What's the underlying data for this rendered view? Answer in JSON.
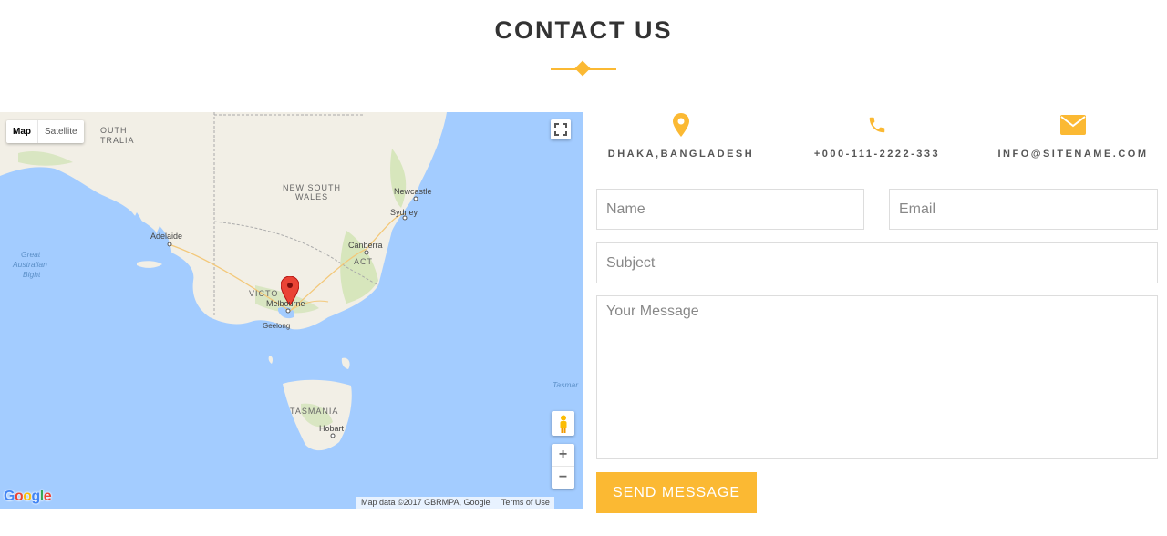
{
  "section": {
    "title": "CONTACT US"
  },
  "map": {
    "type_controls": {
      "map_label": "Map",
      "satellite_label": "Satellite"
    },
    "labels": {
      "south_australia": "OUTH\nTRALIA",
      "new_south_wales_1": "NEW SOUTH",
      "new_south_wales_2": "WALES",
      "newcastle": "Newcastle",
      "sydney": "Sydney",
      "adelaide": "Adelaide",
      "canberra": "Canberra",
      "act": "ACT",
      "great_australian_bight_1": "Great",
      "great_australian_bight_2": "Australian",
      "great_australian_bight_3": "Bight",
      "victoria": "VICTO",
      "melbourne": "Melbourne",
      "geelong": "Geelong",
      "tasmania": "TASMANIA",
      "hobart": "Hobart",
      "tasman": "Tasmar"
    },
    "attribution": {
      "data": "Map data ©2017 GBRMPA, Google",
      "terms": "Terms of Use"
    },
    "logo": "Google",
    "zoom_in": "+",
    "zoom_out": "−"
  },
  "contact_info": {
    "address": "DHAKA,BANGLADESH",
    "phone": "+000-111-2222-333",
    "email": "INFO@SITENAME.COM"
  },
  "form": {
    "name_placeholder": "Name",
    "email_placeholder": "Email",
    "subject_placeholder": "Subject",
    "message_placeholder": "Your Message",
    "send_label": "SEND MESSAGE"
  },
  "colors": {
    "accent": "#fbb933",
    "water": "#a3ccff",
    "land": "#f2efe6"
  },
  "icons": {
    "address": "map-marker-icon",
    "phone": "phone-icon",
    "email": "envelope-icon"
  }
}
